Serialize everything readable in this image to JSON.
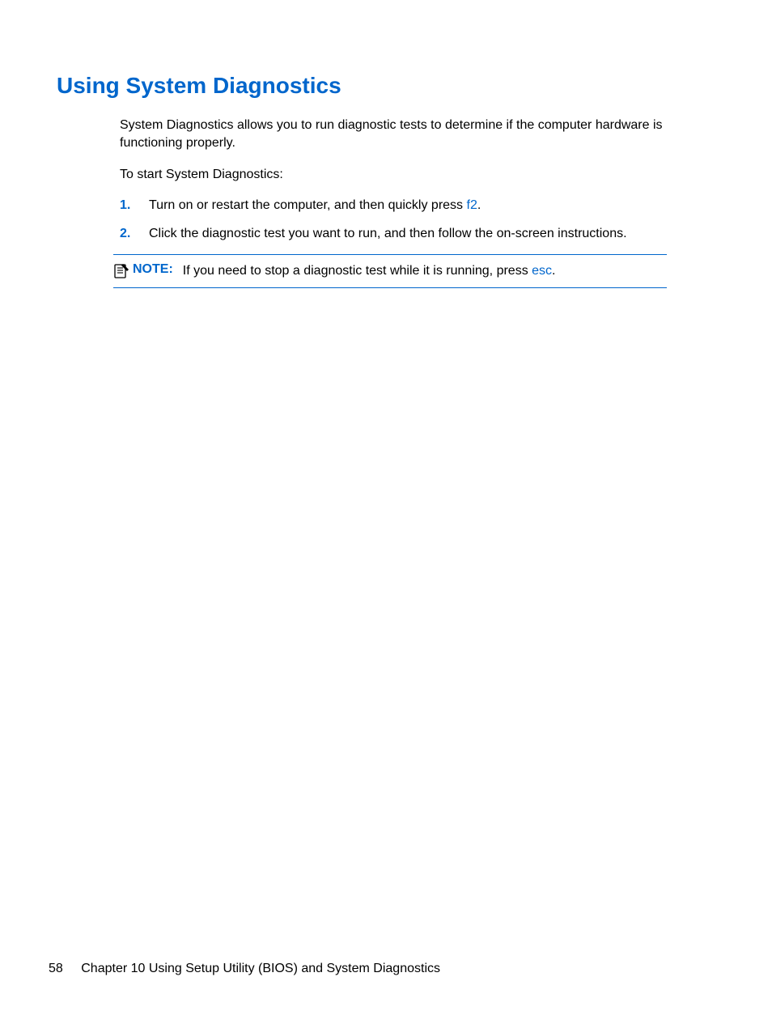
{
  "heading": "Using System Diagnostics",
  "intro": "System Diagnostics allows you to run diagnostic tests to determine if the computer hardware is functioning properly.",
  "start_label": "To start System Diagnostics:",
  "steps": [
    {
      "num": "1.",
      "text_prefix": "Turn on or restart the computer, and then quickly press ",
      "key": "f2",
      "text_suffix": "."
    },
    {
      "num": "2.",
      "text_prefix": "Click the diagnostic test you want to run, and then follow the on-screen instructions.",
      "key": "",
      "text_suffix": ""
    }
  ],
  "note": {
    "label": "NOTE:",
    "text_prefix": "If you need to stop a diagnostic test while it is running, press ",
    "key": "esc",
    "text_suffix": "."
  },
  "footer": {
    "page": "58",
    "chapter": "Chapter 10   Using Setup Utility (BIOS) and System Diagnostics"
  }
}
